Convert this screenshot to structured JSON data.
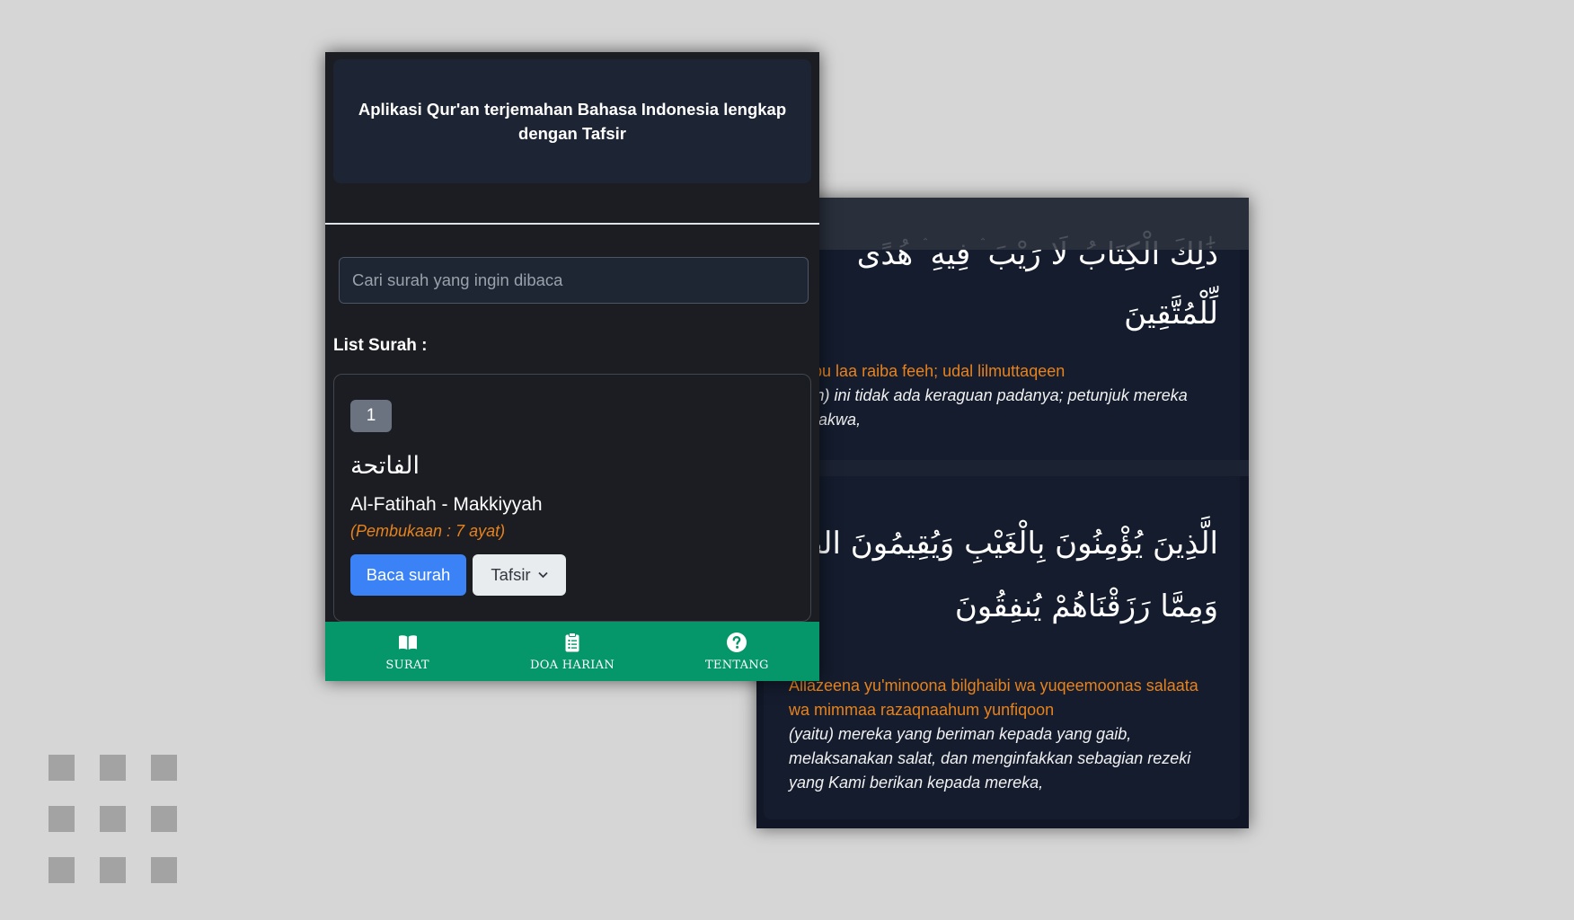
{
  "colors": {
    "background": "#d6d6d6",
    "front_bg": "#1b1d22",
    "hero_bg": "#1d2433",
    "accent_orange": "#e8821c",
    "primary_blue": "#3b82f6",
    "nav_green": "#059669",
    "back_bg": "#111726"
  },
  "header": {
    "title": "Aplikasi Qur'an terjemahan Bahasa Indonesia lengkap dengan Tafsir"
  },
  "search": {
    "placeholder": "Cari surah yang ingin dibaca",
    "value": ""
  },
  "surah_list": {
    "label": "List Surah :",
    "items": [
      {
        "number": "1",
        "arabic": "الفاتحة",
        "name": "Al-Fatihah - Makkiyyah",
        "meaning": "(Pembukaan : 7 ayat)",
        "read_label": "Baca surah",
        "tafsir_label": "Tafsir",
        "tafsir_icon": "chevron-down-icon"
      }
    ]
  },
  "bottom_nav": [
    {
      "label": "SURAT",
      "icon": "book-open-icon"
    },
    {
      "label": "DOA HARIAN",
      "icon": "clipboard-list-icon"
    },
    {
      "label": "TENTANG",
      "icon": "question-circle-icon"
    }
  ],
  "ayat_detail": {
    "ayat": [
      {
        "arabic_line1": "ذَٰلِكَ الْكِتَابُ لَا رَيْبَ ۛ فِيهِ ۛ هُدًى",
        "arabic_line2": "لِّلْمُتَّقِينَ",
        "latin": "kal Kitaabu laa raiba feeh; udal lilmuttaqeen",
        "translation": "(Al-Qur'an) ini tidak ada keraguan padanya; petunjuk mereka yang bertakwa,"
      },
      {
        "arabic_line1": "الَّذِينَ يُؤْمِنُونَ بِالْغَيْبِ وَيُقِيمُونَ الصَّ",
        "arabic_line2": "وَمِمَّا رَزَقْنَاهُمْ يُنفِقُونَ",
        "latin": "Allazeena yu'minoona bilghaibi wa yuqeemoonas salaata wa mimmaa razaqnaahum yunfiqoon",
        "translation": "(yaitu) mereka yang beriman kepada yang gaib, melaksanakan salat, dan menginfakkan sebagian rezeki yang Kami berikan kepada mereka,"
      }
    ]
  }
}
